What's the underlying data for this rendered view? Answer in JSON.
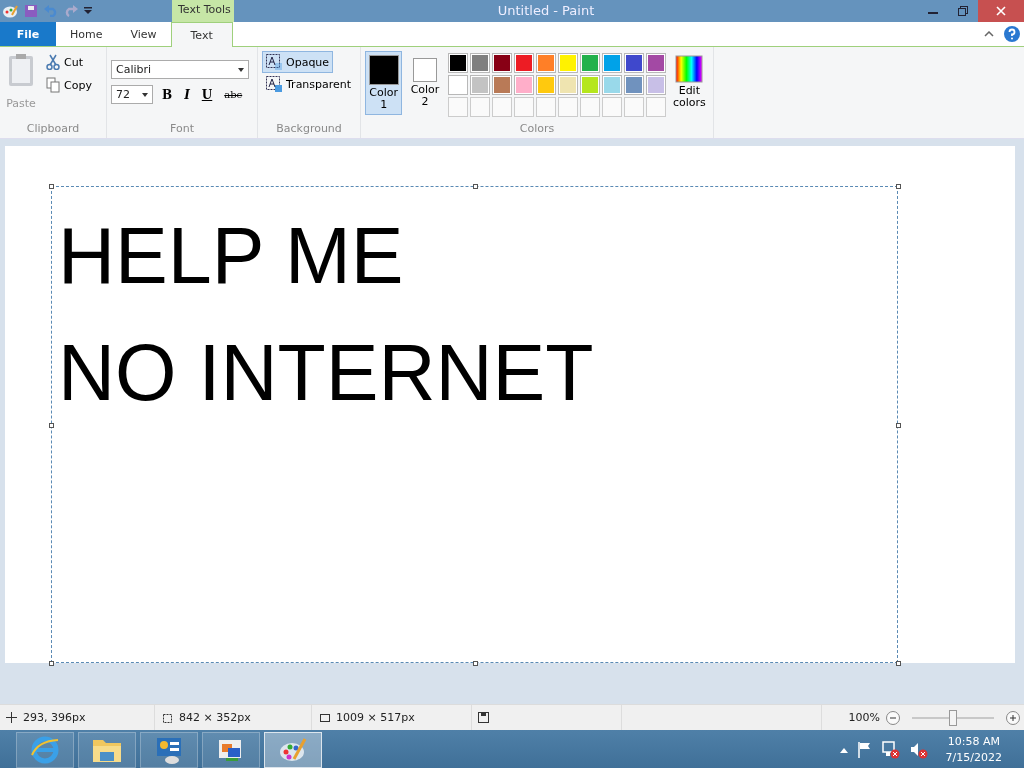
{
  "window": {
    "title": "Untitled - Paint",
    "contextual_tab": "Text Tools"
  },
  "tabs": [
    {
      "label": "File",
      "kind": "file",
      "selected": false
    },
    {
      "label": "Home",
      "kind": "tab",
      "selected": false
    },
    {
      "label": "View",
      "kind": "tab",
      "selected": false
    },
    {
      "label": "Text",
      "kind": "tab",
      "selected": true
    }
  ],
  "clipboard": {
    "paste": "Paste",
    "paste_disabled": true,
    "cut": "Cut",
    "copy": "Copy",
    "group": "Clipboard"
  },
  "font": {
    "family": "Calibri",
    "size": "72",
    "styles": [
      "B",
      "I",
      "U",
      "abc"
    ],
    "group": "Font"
  },
  "background": {
    "options": [
      {
        "label": "Opaque",
        "selected": true
      },
      {
        "label": "Transparent",
        "selected": false
      }
    ],
    "group": "Background"
  },
  "colors": {
    "slots": [
      {
        "label": "Color 1",
        "color": "#000000",
        "selected": true
      },
      {
        "label": "Color 2",
        "color": "#ffffff",
        "selected": false
      }
    ],
    "palette": [
      {
        "color": "#000000"
      },
      {
        "color": "#7f7f7f"
      },
      {
        "color": "#880015"
      },
      {
        "color": "#ed1c24"
      },
      {
        "color": "#ff7f27"
      },
      {
        "color": "#fff200"
      },
      {
        "color": "#22b14c"
      },
      {
        "color": "#00a2e8"
      },
      {
        "color": "#3f48cc"
      },
      {
        "color": "#a349a4"
      },
      {
        "color": "#ffffff"
      },
      {
        "color": "#c3c3c3"
      },
      {
        "color": "#b97a57"
      },
      {
        "color": "#ffaec9"
      },
      {
        "color": "#ffc90e"
      },
      {
        "color": "#efe4b0"
      },
      {
        "color": "#b5e61d"
      },
      {
        "color": "#99d9ea"
      },
      {
        "color": "#7092be"
      },
      {
        "color": "#c8bfe7"
      }
    ],
    "edit": "Edit colors",
    "group": "Colors"
  },
  "canvas": {
    "lines": [
      "HELP ME",
      "NO INTERNET"
    ]
  },
  "status_bar": {
    "cursor": "293, 396px",
    "selection": "842 × 352px",
    "size": "1009 × 517px",
    "zoom": "100%",
    "level": 0.5
  },
  "taskbar": {
    "apps": [
      {
        "kind": "browser",
        "selected": false
      },
      {
        "kind": "folder",
        "selected": false
      },
      {
        "kind": "control",
        "selected": false
      },
      {
        "kind": "network",
        "selected": false
      },
      {
        "kind": "paint",
        "selected": true
      }
    ],
    "time": "10:58 AM",
    "date": "7/15/2022"
  }
}
